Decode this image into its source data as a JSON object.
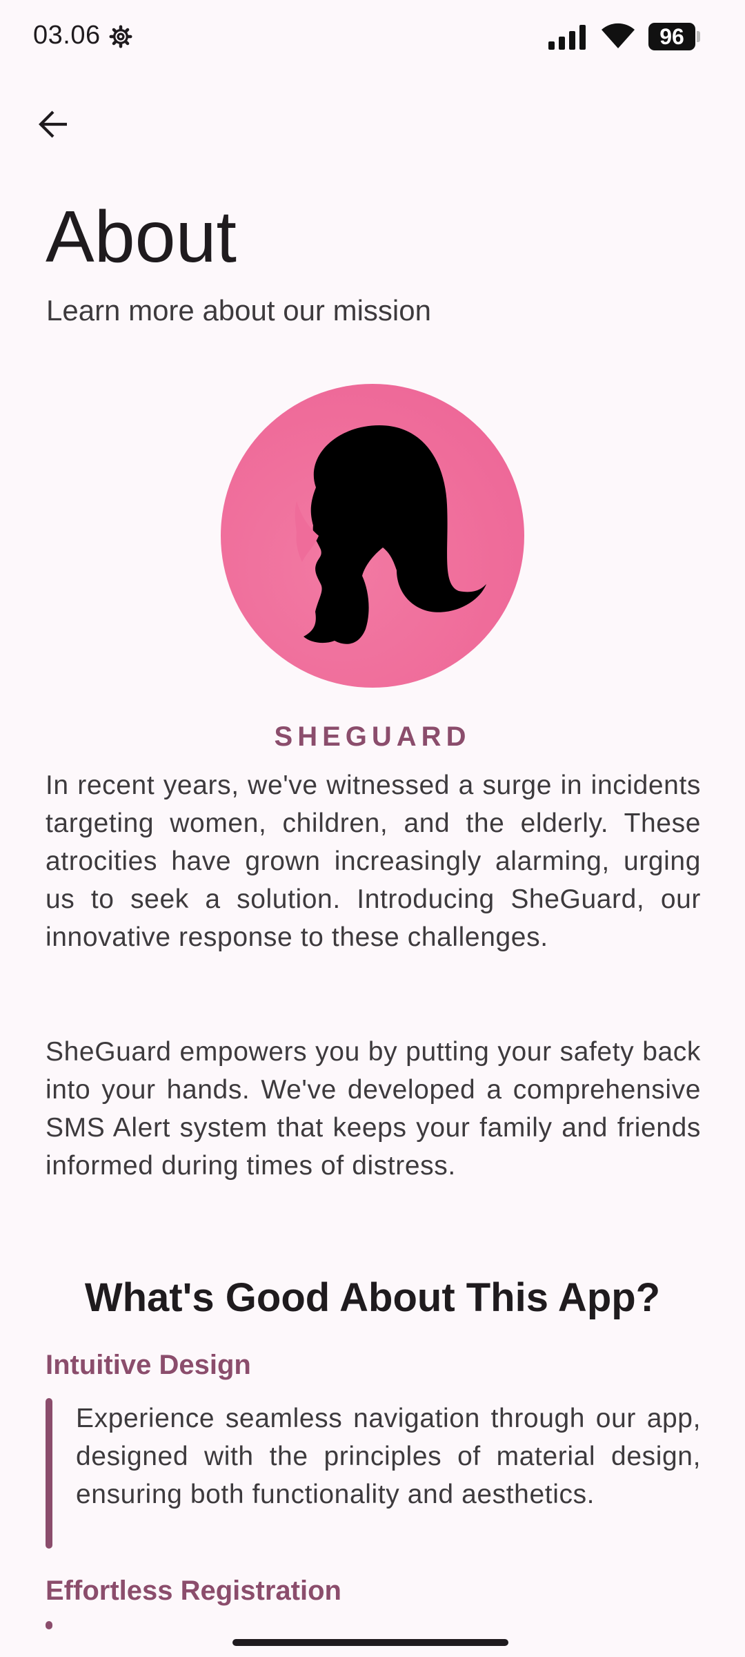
{
  "status_bar": {
    "time": "03.06",
    "battery": "96",
    "icons": [
      "gear-icon",
      "signal-icon",
      "wifi-icon",
      "battery-icon"
    ]
  },
  "header": {
    "back_icon": "arrow-left-icon",
    "title": "About",
    "subtitle": "Learn more about our mission"
  },
  "logo": {
    "icon": "woman-silhouette-logo",
    "background_color": "#ef6c9a"
  },
  "app": {
    "name": "SHEGUARD",
    "accent_color": "#8b4d6c"
  },
  "intro": {
    "paragraph_1": "In recent years, we've witnessed a surge in incidents targeting women, children, and the elderly. These atrocities have grown increasingly alarming, urging us to seek a solution. Introducing SheGuard, our innovative response to these challenges.",
    "paragraph_2": "SheGuard empowers you by putting your safety back into your hands. We've developed a comprehensive SMS Alert system that keeps your family and friends informed during times of distress."
  },
  "features": {
    "heading": "What's Good About This App?",
    "items": [
      {
        "title": "Intuitive Design",
        "description": "Experience seamless navigation through our app, designed with the principles of material design, ensuring both functionality and aesthetics."
      },
      {
        "title": "Effortless Registration"
      }
    ]
  }
}
